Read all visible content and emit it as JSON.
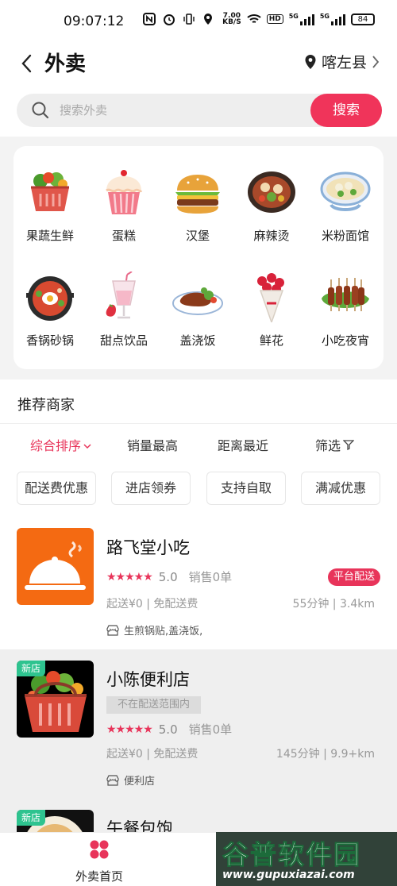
{
  "status_bar": {
    "time": "09:07:12",
    "speed": "7.00",
    "speed_unit": "KB/S",
    "battery": "84",
    "network_a": "5G",
    "network_b": "5G",
    "hd": "HD"
  },
  "header": {
    "title": "外卖",
    "location": "喀左县"
  },
  "search": {
    "placeholder": "搜索外卖",
    "button": "搜索"
  },
  "categories": [
    {
      "label": "果蔬生鲜",
      "icon": "produce-basket-icon"
    },
    {
      "label": "蛋糕",
      "icon": "cupcake-icon"
    },
    {
      "label": "汉堡",
      "icon": "burger-icon"
    },
    {
      "label": "麻辣烫",
      "icon": "hotpot-bowl-icon"
    },
    {
      "label": "米粉面馆",
      "icon": "noodle-bowl-icon"
    },
    {
      "label": "香锅砂锅",
      "icon": "claypot-icon"
    },
    {
      "label": "甜点饮品",
      "icon": "drink-glass-icon"
    },
    {
      "label": "盖浇饭",
      "icon": "steak-plate-icon"
    },
    {
      "label": "鲜花",
      "icon": "flower-bouquet-icon"
    },
    {
      "label": "小吃夜宵",
      "icon": "skewers-icon"
    }
  ],
  "recommend": {
    "title": "推荐商家",
    "sort": [
      "综合排序",
      "销量最高",
      "距离最近",
      "筛选"
    ],
    "chips": [
      "配送费优惠",
      "进店领券",
      "支持自取",
      "满减优惠"
    ]
  },
  "stores": [
    {
      "name": "路飞堂小吃",
      "rating": "5.0",
      "sales": "销售0单",
      "badge": "平台配送",
      "fee": "起送¥0 | 免配送费",
      "eta": "55分钟 | 3.4km",
      "tags": "生煎锅贴,盖浇饭,"
    },
    {
      "name": "小陈便利店",
      "new": "新店",
      "out_of_range": "不在配送范围内",
      "rating": "5.0",
      "sales": "销售0单",
      "fee": "起送¥0 | 免配送费",
      "eta": "145分钟 | 9.9+km",
      "tags": "便利店"
    },
    {
      "name": "午餐包饱",
      "new": "新店"
    }
  ],
  "bottom_nav": {
    "home": "外卖首页"
  },
  "watermark": {
    "title": "谷普软件园",
    "url": "www.gupuxiazai.com"
  },
  "colors": {
    "accent": "#e8345a",
    "new_badge": "#2ec38f",
    "store_logo_bg": "#f46a12"
  }
}
